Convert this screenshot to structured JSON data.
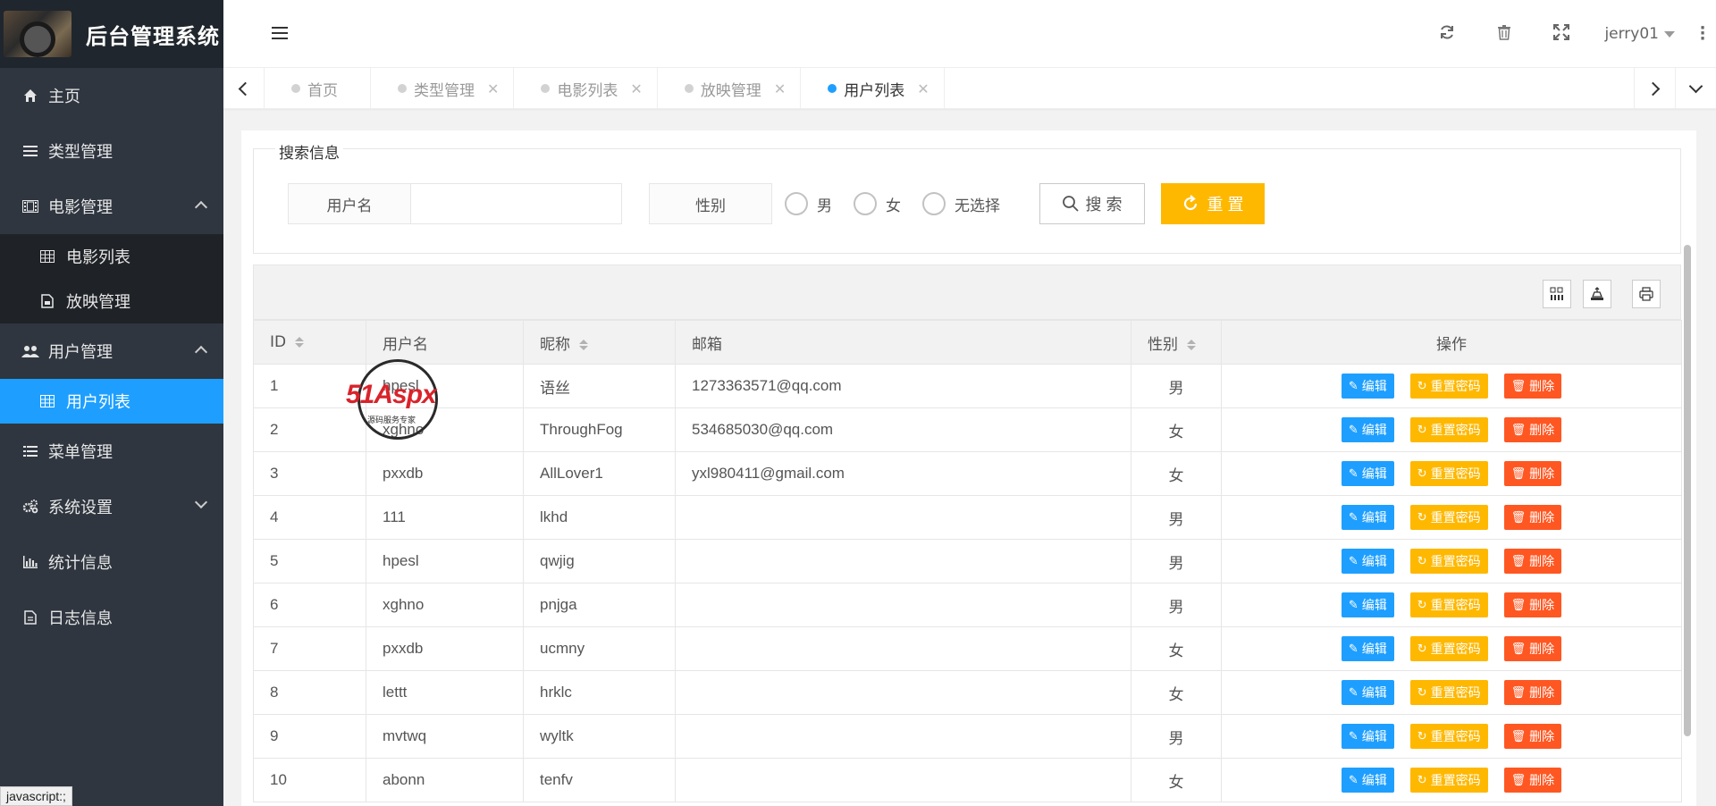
{
  "app": {
    "title": "后台管理系统"
  },
  "sidebar": {
    "items": [
      {
        "label": "主页",
        "icon": "home-icon"
      },
      {
        "label": "类型管理",
        "icon": "bars-icon"
      },
      {
        "label": "电影管理",
        "icon": "film-icon",
        "expanded": true,
        "children": [
          {
            "label": "电影列表",
            "icon": "table-icon"
          },
          {
            "label": "放映管理",
            "icon": "file-icon"
          }
        ]
      },
      {
        "label": "用户管理",
        "icon": "users-icon",
        "expanded": true,
        "children": [
          {
            "label": "用户列表",
            "icon": "table-icon",
            "active": true
          }
        ]
      },
      {
        "label": "菜单管理",
        "icon": "list-icon"
      },
      {
        "label": "系统设置",
        "icon": "gears-icon"
      },
      {
        "label": "统计信息",
        "icon": "bar-chart-icon"
      },
      {
        "label": "日志信息",
        "icon": "log-icon"
      }
    ]
  },
  "header": {
    "user": "jerry01"
  },
  "tabs": [
    {
      "label": "首页",
      "closable": false
    },
    {
      "label": "类型管理",
      "closable": true
    },
    {
      "label": "电影列表",
      "closable": true
    },
    {
      "label": "放映管理",
      "closable": true
    },
    {
      "label": "用户列表",
      "closable": true,
      "active": true
    }
  ],
  "search": {
    "legend": "搜索信息",
    "username_label": "用户名",
    "username_value": "",
    "gender_label": "性别",
    "options": [
      "男",
      "女",
      "无选择"
    ],
    "search_button": "搜 索",
    "reset_button": "重 置"
  },
  "table": {
    "columns": [
      "ID",
      "用户名",
      "昵称",
      "邮箱",
      "性别",
      "操作"
    ],
    "actions": {
      "edit": "编辑",
      "reset": "重置密码",
      "delete": "删除"
    },
    "rows": [
      {
        "id": "1",
        "username": "hpesl",
        "nickname": "语丝",
        "email": "1273363571@qq.com",
        "gender": "男"
      },
      {
        "id": "2",
        "username": "xghno",
        "nickname": "ThroughFog",
        "email": "534685030@qq.com",
        "gender": "女"
      },
      {
        "id": "3",
        "username": "pxxdb",
        "nickname": "AllLover1",
        "email": "yxl980411@gmail.com",
        "gender": "女"
      },
      {
        "id": "4",
        "username": "111",
        "nickname": "lkhd",
        "email": "",
        "gender": "男"
      },
      {
        "id": "5",
        "username": "hpesl",
        "nickname": "qwjig",
        "email": "",
        "gender": "男"
      },
      {
        "id": "6",
        "username": "xghno",
        "nickname": "pnjga",
        "email": "",
        "gender": "男"
      },
      {
        "id": "7",
        "username": "pxxdb",
        "nickname": "ucmny",
        "email": "",
        "gender": "女"
      },
      {
        "id": "8",
        "username": "lettt",
        "nickname": "hrklc",
        "email": "",
        "gender": "女"
      },
      {
        "id": "9",
        "username": "mvtwq",
        "nickname": "wyltk",
        "email": "",
        "gender": "男"
      },
      {
        "id": "10",
        "username": "abonn",
        "nickname": "tenfv",
        "email": "",
        "gender": "女"
      }
    ]
  },
  "watermark": {
    "brand": "51Aspx",
    "tagline": "源码服务专家"
  },
  "status_text": "javascript:;",
  "colors": {
    "sidebar": "#2f3640",
    "accent": "#1e9fff",
    "warning": "#ffb800",
    "danger": "#ff5722"
  }
}
